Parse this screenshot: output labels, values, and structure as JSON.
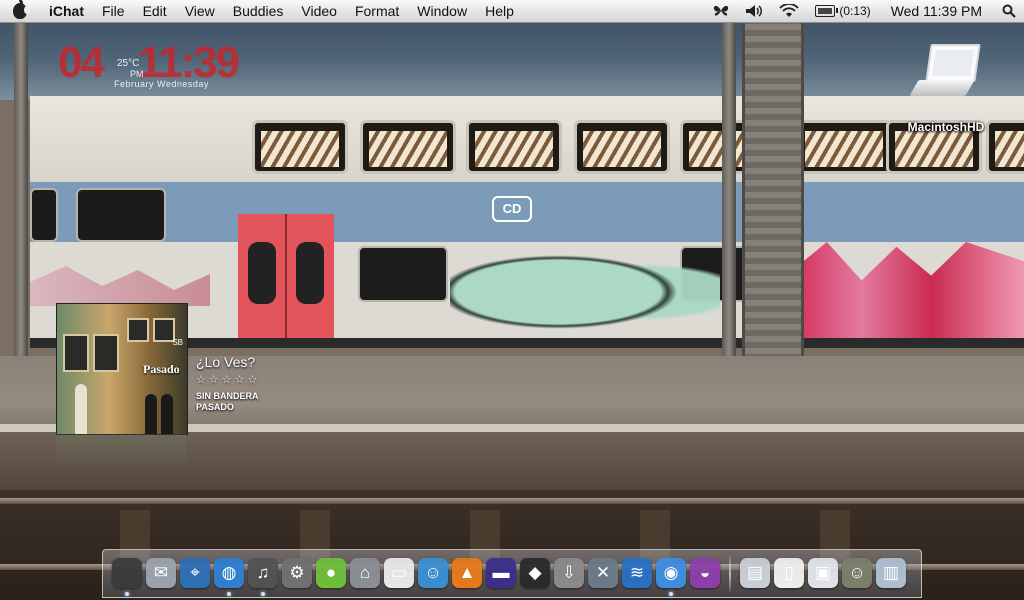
{
  "menubar": {
    "app_name": "iChat",
    "items": [
      "File",
      "Edit",
      "View",
      "Buddies",
      "Video",
      "Format",
      "Window",
      "Help"
    ],
    "battery_text": "(0:13)",
    "clock_text": "Wed 11:39 PM"
  },
  "clock_widget": {
    "hour": "04",
    "minute": "11:39",
    "temperature": "25°C",
    "ampm": "PM",
    "date": "February Wednesday"
  },
  "desktop": {
    "hd_label": "MacintoshHD"
  },
  "now_playing": {
    "album_cover_text": "Pasado",
    "album_cover_badge": "SB",
    "song": "¿Lo Ves?",
    "rating": "☆☆☆☆☆",
    "artist": "SIN BANDERA",
    "album": "PASADO"
  },
  "dock": {
    "apps": [
      {
        "name": "finder-icon",
        "glyph": "",
        "color": "#3b3b3b",
        "running": true
      },
      {
        "name": "mail-icon",
        "glyph": "✉",
        "color": "#9aa3ad",
        "running": false
      },
      {
        "name": "safari-icon",
        "glyph": "⌖",
        "color": "#2d6fb4",
        "running": false
      },
      {
        "name": "network-globe-icon",
        "glyph": "◍",
        "color": "#2f7fd1",
        "running": true
      },
      {
        "name": "itunes-headphones-icon",
        "glyph": "♫",
        "color": "#525252",
        "running": true
      },
      {
        "name": "system-preferences-icon",
        "glyph": "⚙",
        "color": "#707070",
        "running": false
      },
      {
        "name": "quicktime-disc-icon",
        "glyph": "●",
        "color": "#6fbf3a",
        "running": false
      },
      {
        "name": "disk-utility-icon",
        "glyph": "⌂",
        "color": "#8a8f95",
        "running": false
      },
      {
        "name": "front-row-icon",
        "glyph": "▭",
        "color": "#e8e8e8",
        "running": false
      },
      {
        "name": "buddies-icon",
        "glyph": "☺",
        "color": "#3a8fd0",
        "running": false
      },
      {
        "name": "vlc-cone-icon",
        "glyph": "▲",
        "color": "#e57a1c",
        "running": false
      },
      {
        "name": "snickers-icon",
        "glyph": "▬",
        "color": "#3a2f8a",
        "running": false
      },
      {
        "name": "mask-icon",
        "glyph": "◆",
        "color": "#2a2a2a",
        "running": false
      },
      {
        "name": "downloader-icon",
        "glyph": "⇩",
        "color": "#8a8a8a",
        "running": false
      },
      {
        "name": "utilities-tools-icon",
        "glyph": "✕",
        "color": "#6b7a88",
        "running": false
      },
      {
        "name": "airport-wifi-icon",
        "glyph": "≋",
        "color": "#2a6fc2",
        "running": false
      },
      {
        "name": "ichat-icon",
        "glyph": "◉",
        "color": "#3f8de0",
        "running": true
      },
      {
        "name": "camino-icon",
        "glyph": "◒",
        "color": "#8c3fa8",
        "running": false
      }
    ],
    "docs": [
      {
        "name": "documents-folder-icon",
        "glyph": "▤",
        "color": "#c9cfd6"
      },
      {
        "name": "file-icon",
        "glyph": "▯",
        "color": "#eeeeee"
      },
      {
        "name": "preview-icon",
        "glyph": "▣",
        "color": "#dfe4ea"
      },
      {
        "name": "photo-thumbnail-icon",
        "glyph": "☺",
        "color": "#7a7f6a"
      },
      {
        "name": "trash-icon",
        "glyph": "▥",
        "color": "#aebfd0"
      }
    ]
  }
}
